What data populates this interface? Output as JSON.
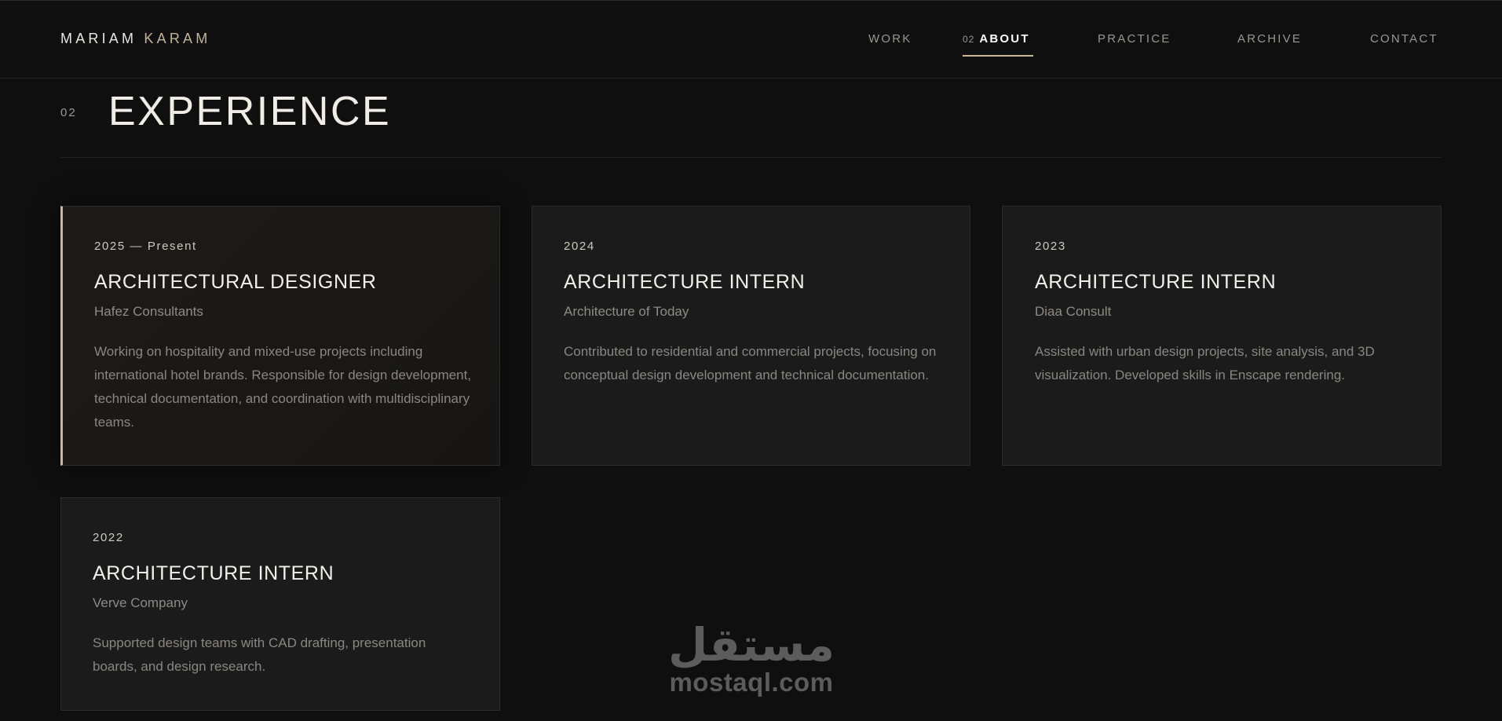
{
  "brand": {
    "first": "MARIAM",
    "last": "KARAM"
  },
  "nav": {
    "items": [
      {
        "label": "WORK",
        "num": "",
        "active": false
      },
      {
        "label": "ABOUT",
        "num": "02",
        "active": true
      },
      {
        "label": "PRACTICE",
        "num": "",
        "active": false
      },
      {
        "label": "ARCHIVE",
        "num": "",
        "active": false
      },
      {
        "label": "CONTACT",
        "num": "",
        "active": false
      }
    ]
  },
  "section": {
    "num": "02",
    "title": "EXPERIENCE"
  },
  "experience": [
    {
      "date": "2025 — Present",
      "role": "ARCHITECTURAL DESIGNER",
      "company": "Hafez Consultants",
      "desc": "Working on hospitality and mixed-use projects including international hotel brands. Responsible for design development, technical documentation, and coordination with multidisciplinary teams."
    },
    {
      "date": "2024",
      "role": "ARCHITECTURE INTERN",
      "company": "Architecture of Today",
      "desc": "Contributed to residential and commercial projects, focusing on conceptual design development and technical documentation."
    },
    {
      "date": "2023",
      "role": "ARCHITECTURE INTERN",
      "company": "Diaa Consult",
      "desc": "Assisted with urban design projects, site analysis, and 3D visualization. Developed skills in Enscape rendering."
    },
    {
      "date": "2022",
      "role": "ARCHITECTURE INTERN",
      "company": "Verve Company",
      "desc": "Supported design teams with CAD drafting, presentation boards, and design research."
    }
  ],
  "watermark": {
    "arabic": "مستقل",
    "latin": "mostaql.com"
  },
  "colors": {
    "accent": "#c9b89a",
    "background": "#0f0f0f",
    "card": "#1b1b1b"
  }
}
